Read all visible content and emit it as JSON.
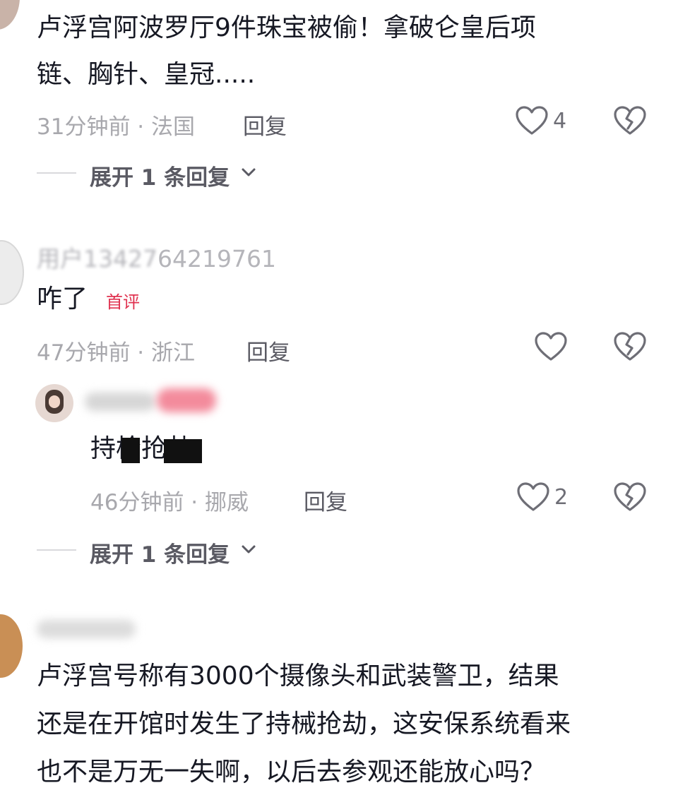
{
  "comments": [
    {
      "text_line1": "卢浮宫阿波罗厅9件珠宝被偷！拿破仑皇后项",
      "text_line2": "链、胸针、皇冠.....",
      "time_loc": "31分钟前 · 法国",
      "reply_label": "回复",
      "likes": "4",
      "expand_label": "展开 1 条回复"
    },
    {
      "username": "用户13427",
      "username_tail": "64219761",
      "text": "咋了",
      "badge": "首评",
      "time_loc": "47分钟前 · 浙江",
      "reply_label": "回复"
    },
    {
      "text": "持枪抢劫",
      "time_loc": "46分钟前 · 挪威",
      "reply_label": "回复",
      "likes": "2",
      "expand_label": "展开 1 条回复"
    },
    {
      "text_line1": "卢浮宫号称有3000个摄像头和武装警卫，结果",
      "text_line2": "还是在开馆时发生了持械抢劫，这安保系统看来",
      "text_line3": "也不是万无一失啊，以后去参观还能放心吗？"
    }
  ],
  "colors": {
    "badge": "#e0314f",
    "meta": "#a8a8ad"
  },
  "icons": [
    "heart-outline-icon",
    "broken-heart-icon",
    "chevron-down-icon"
  ]
}
